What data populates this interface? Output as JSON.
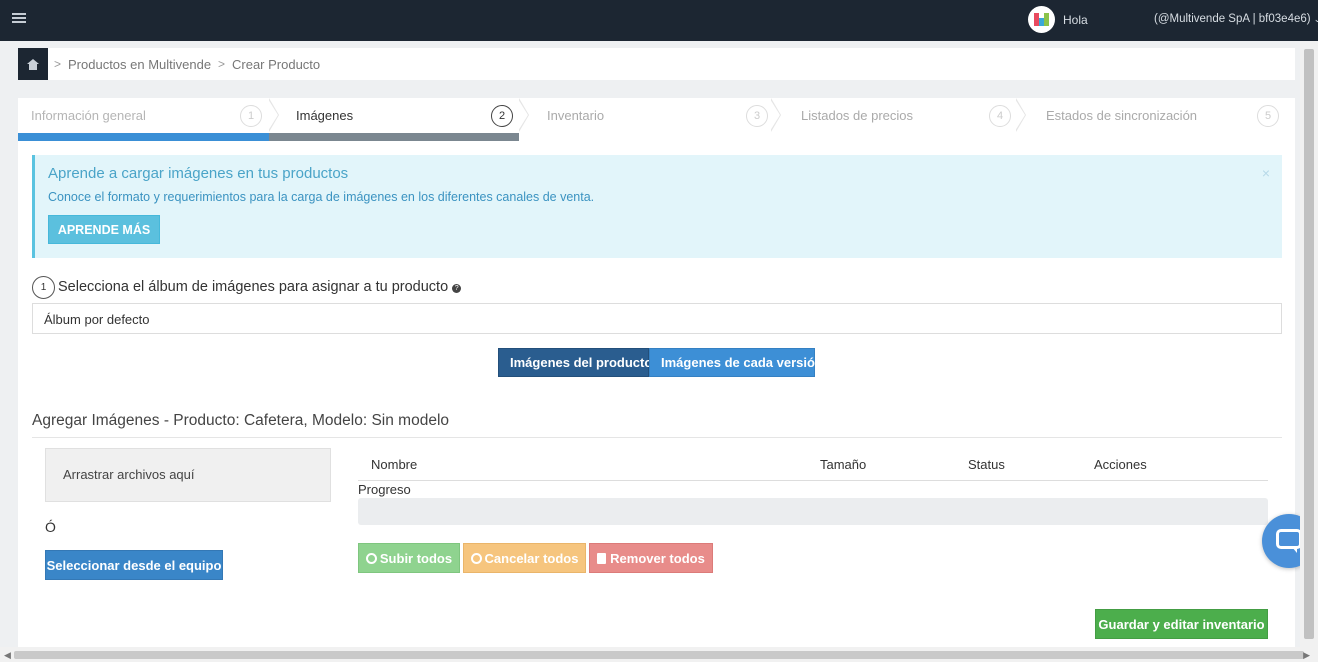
{
  "topbar": {
    "icons": {
      "menu": "menu-toggle-icon",
      "avatar": "multivende-logo-icon",
      "caret": "chevron-down-icon"
    },
    "greeting": "Hola",
    "account": "(@Multivende SpA | bf03e4e6)",
    "caret_glyph": "⌄"
  },
  "breadcrumb": {
    "home_icon": "home-icon",
    "separator": ">",
    "items": [
      "Productos en Multivende",
      "Crear Producto"
    ]
  },
  "wizard": {
    "steps": [
      {
        "label": "Información general",
        "number": "1",
        "state": "done"
      },
      {
        "label": "Imágenes",
        "number": "2",
        "state": "active"
      },
      {
        "label": "Inventario",
        "number": "3",
        "state": "todo"
      },
      {
        "label": "Listados de precios",
        "number": "4",
        "state": "todo"
      },
      {
        "label": "Estados de sincronización",
        "number": "5",
        "state": "todo"
      }
    ]
  },
  "alert": {
    "title": "Aprende a cargar imágenes en tus productos",
    "text": "Conoce el formato y requerimientos para la carga de imágenes en los diferentes canales de venta.",
    "close": "×",
    "button": "APRENDE MÁS"
  },
  "album": {
    "step_number": "1",
    "title": "Selecciona el álbum de imágenes para asignar a tu producto",
    "help_glyph": "?",
    "selected": "Álbum por defecto"
  },
  "image_tabs": {
    "product": "Imágenes del producto",
    "versions": "Imágenes de cada versión",
    "active": "product"
  },
  "upload": {
    "title": "Agregar Imágenes - Producto: Cafetera, Modelo: Sin modelo",
    "dropzone": "Arrastrar archivos aquí",
    "or": "Ó",
    "select_button": "Seleccionar desde el equipo",
    "columns": [
      "Nombre",
      "Tamaño",
      "Status",
      "Acciones"
    ],
    "progress_label": "Progreso",
    "progress_value": 0,
    "actions": {
      "upload_all": "Subir todos",
      "cancel_all": "Cancelar todos",
      "remove_all": "Remover todos"
    }
  },
  "footer": {
    "save_button": "Guardar y editar inventario"
  },
  "colors": {
    "topbar": "#1c2632",
    "step_done": "#3a8fd6",
    "step_active": "#7b8790",
    "info": "#5bc0de",
    "primary": "#3a86c8",
    "success": "#4cae4c",
    "warning": "#f6c57e",
    "danger": "#e88c8a"
  }
}
